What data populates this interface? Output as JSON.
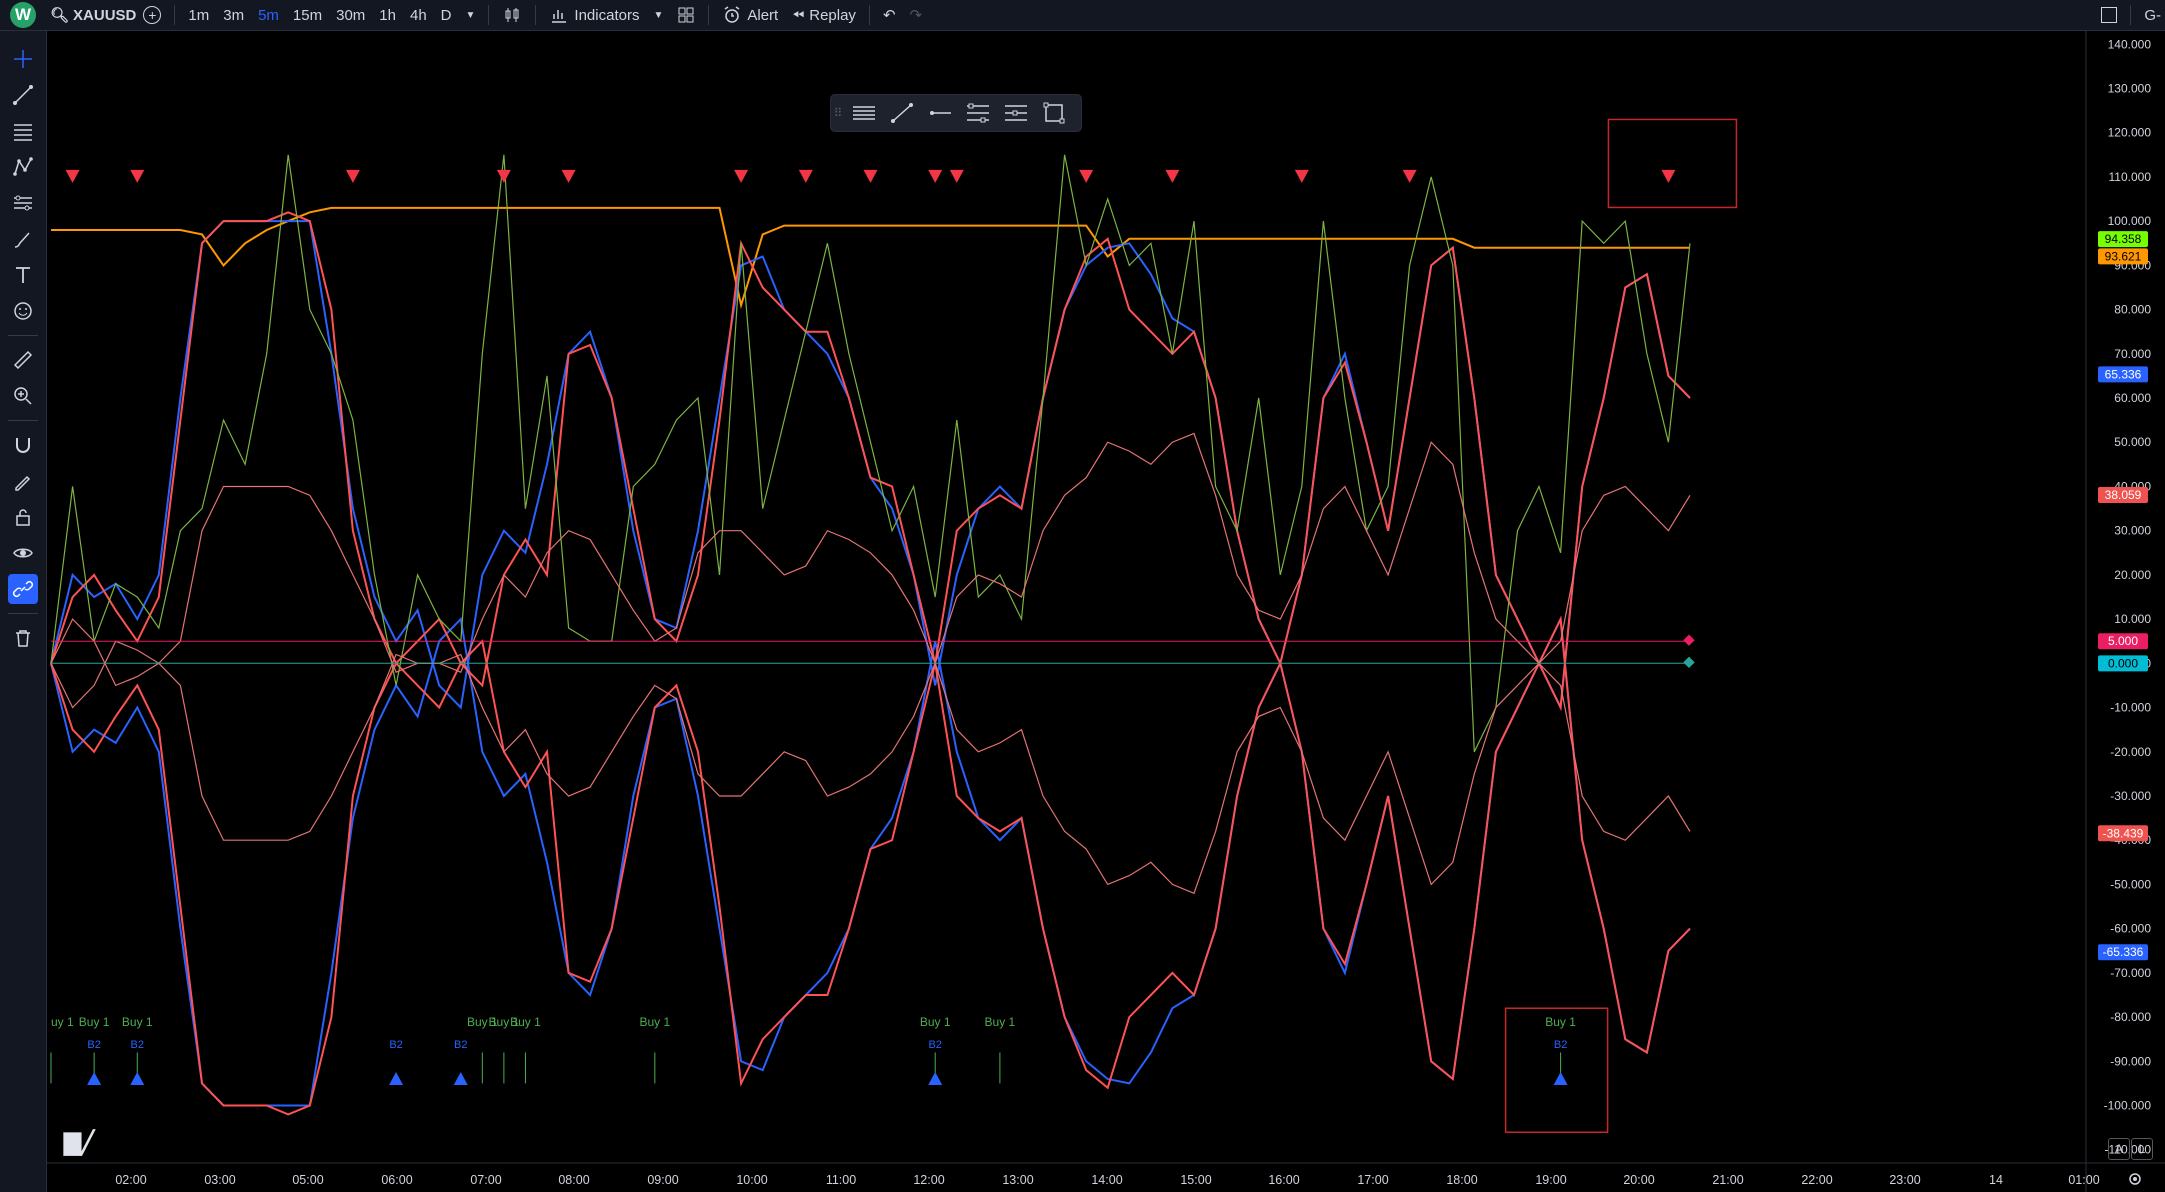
{
  "app": {
    "logo_letter": "W",
    "symbol": "XAUUSD",
    "timeframes": [
      "1m",
      "3m",
      "5m",
      "15m",
      "30m",
      "1h",
      "4h",
      "D"
    ],
    "active_timeframe": "5m",
    "indicators_label": "Indicators",
    "alert_label": "Alert",
    "replay_label": "Replay",
    "right_label": "G-",
    "accent_color": "#2962ff"
  },
  "chart": {
    "price_scale_labels": [
      "140.000",
      "130.000",
      "120.000",
      "110.000",
      "100.000",
      "90.000",
      "80.000",
      "70.000",
      "60.000",
      "50.000",
      "40.000",
      "30.000",
      "20.000",
      "10.000",
      "0.000",
      "-10.000",
      "-20.000",
      "-30.000",
      "-40.000",
      "-50.000",
      "-60.000",
      "-70.000",
      "-80.000",
      "-90.000",
      "-100.000",
      "-110.000"
    ],
    "time_labels": [
      "02:00",
      "03:00",
      "05:00",
      "06:00",
      "07:00",
      "08:00",
      "09:00",
      "10:00",
      "11:00",
      "12:00",
      "13:00",
      "14:00",
      "15:00",
      "16:00",
      "17:00",
      "18:00",
      "19:00",
      "20:00",
      "21:00",
      "22:00",
      "23:00",
      "14",
      "01:00"
    ],
    "badges": [
      {
        "text": "94.358",
        "value": 94.358,
        "color": "#76ff03",
        "text_color": "#000"
      },
      {
        "text": "93.621",
        "value": 93.621,
        "color": "#ff9800",
        "text_color": "#000"
      },
      {
        "text": "65.336",
        "value": 65.336,
        "color": "#2962ff",
        "text_color": "#fff"
      },
      {
        "text": "38.059",
        "value": 38.059,
        "color": "#ef5350",
        "text_color": "#fff"
      },
      {
        "text": "5.000",
        "value": 5.0,
        "color": "#e91e63",
        "text_color": "#fff"
      },
      {
        "text": "0.000",
        "value": 0.0,
        "color": "#00bcd4",
        "text_color": "#000"
      },
      {
        "text": "-38.439",
        "value": -38.439,
        "color": "#ef5350",
        "text_color": "#fff"
      },
      {
        "text": "-65.336",
        "value": -65.336,
        "color": "#2962ff",
        "text_color": "#fff"
      }
    ],
    "signal_label_buy": "Buy 1",
    "signal_label_buy_partial": "uy 1",
    "signal_label_b2": "B2",
    "corner_buttons": [
      "A",
      "L"
    ]
  },
  "chart_data": {
    "type": "line",
    "ylim": [
      -113,
      143
    ],
    "x": [
      "01:30",
      "01:45",
      "02:00",
      "02:15",
      "02:30",
      "02:45",
      "03:00",
      "03:15",
      "03:30",
      "03:45",
      "04:00",
      "04:15",
      "04:30",
      "04:45",
      "05:00",
      "05:15",
      "05:30",
      "05:45",
      "06:00",
      "06:15",
      "06:30",
      "06:45",
      "07:00",
      "07:15",
      "07:30",
      "07:45",
      "08:00",
      "08:15",
      "08:30",
      "08:45",
      "09:00",
      "09:15",
      "09:30",
      "09:45",
      "10:00",
      "10:15",
      "10:30",
      "10:45",
      "11:00",
      "11:15",
      "11:30",
      "11:45",
      "12:00",
      "12:15",
      "12:30",
      "12:45",
      "13:00",
      "13:15",
      "13:30",
      "13:45",
      "14:00",
      "14:15",
      "14:30",
      "14:45",
      "15:00",
      "15:15",
      "15:30",
      "15:45",
      "16:00",
      "16:15",
      "16:30",
      "16:45",
      "17:00",
      "17:15",
      "17:30",
      "17:45",
      "18:00",
      "18:15",
      "18:30",
      "18:45",
      "19:00",
      "19:15",
      "19:30",
      "19:45",
      "20:00",
      "20:15",
      "20:30"
    ],
    "series": [
      {
        "color": "#ff9800",
        "values": [
          98,
          98,
          98,
          98,
          98,
          98,
          98,
          97,
          90,
          95,
          98,
          100,
          102,
          103,
          103,
          103,
          103,
          103,
          103,
          103,
          103,
          103,
          103,
          103,
          103,
          103,
          103,
          103,
          103,
          103,
          103,
          103,
          81,
          97,
          99,
          99,
          99,
          99,
          99,
          99,
          99,
          99,
          99,
          99,
          99,
          99,
          99,
          99,
          99,
          92,
          96,
          96,
          96,
          96,
          96,
          96,
          96,
          96,
          96,
          96,
          96,
          96,
          96,
          96,
          96,
          96,
          94,
          94,
          94,
          94,
          94,
          94,
          94,
          94,
          94,
          94,
          94
        ]
      },
      {
        "color": "#2962ff",
        "values": [
          0,
          20,
          15,
          18,
          10,
          20,
          60,
          95,
          100,
          100,
          100,
          100,
          100,
          70,
          35,
          15,
          5,
          12,
          -5,
          -10,
          20,
          30,
          25,
          45,
          70,
          75,
          60,
          30,
          10,
          8,
          30,
          60,
          90,
          92,
          80,
          75,
          70,
          60,
          42,
          35,
          20,
          -5,
          20,
          35,
          40,
          35,
          60,
          80,
          90,
          94,
          95,
          88,
          78,
          75,
          60,
          30,
          10,
          0,
          20,
          60,
          70,
          50,
          30,
          60,
          90,
          94,
          60,
          20,
          10,
          0,
          -10,
          40,
          60,
          85,
          88,
          65,
          60
        ]
      },
      {
        "color": "#2962ff",
        "values": [
          0,
          -20,
          -15,
          -18,
          -10,
          -20,
          -60,
          -95,
          -100,
          -100,
          -100,
          -100,
          -100,
          -70,
          -35,
          -15,
          -5,
          -12,
          5,
          10,
          -20,
          -30,
          -25,
          -45,
          -70,
          -75,
          -60,
          -30,
          -10,
          -8,
          -30,
          -60,
          -90,
          -92,
          -80,
          -75,
          -70,
          -60,
          -42,
          -35,
          -20,
          5,
          -20,
          -35,
          -40,
          -35,
          -60,
          -80,
          -90,
          -94,
          -95,
          -88,
          -78,
          -75,
          -60,
          -30,
          -10,
          0,
          -20,
          -60,
          -70,
          -50,
          -30,
          -60,
          -90,
          -94,
          -60,
          -20,
          -10,
          0,
          10,
          -40,
          -60,
          -85,
          -88,
          -65,
          -60
        ]
      },
      {
        "color": "#ff5252",
        "values": [
          0,
          15,
          20,
          12,
          5,
          15,
          55,
          95,
          100,
          100,
          100,
          102,
          100,
          80,
          30,
          10,
          0,
          5,
          10,
          0,
          -5,
          20,
          28,
          20,
          70,
          72,
          60,
          35,
          10,
          5,
          20,
          55,
          95,
          85,
          80,
          75,
          75,
          60,
          42,
          40,
          20,
          0,
          30,
          35,
          38,
          35,
          60,
          80,
          92,
          96,
          80,
          75,
          70,
          75,
          60,
          30,
          10,
          0,
          20,
          60,
          68,
          50,
          30,
          60,
          90,
          94,
          60,
          20,
          10,
          0,
          -10,
          40,
          60,
          85,
          88,
          65,
          60
        ]
      },
      {
        "color": "#ff5252",
        "values": [
          0,
          -15,
          -20,
          -12,
          -5,
          -15,
          -55,
          -95,
          -100,
          -100,
          -100,
          -102,
          -100,
          -80,
          -30,
          -10,
          0,
          -5,
          -10,
          0,
          5,
          -20,
          -28,
          -20,
          -70,
          -72,
          -60,
          -35,
          -10,
          -5,
          -20,
          -55,
          -95,
          -85,
          -80,
          -75,
          -75,
          -60,
          -42,
          -40,
          -20,
          0,
          -30,
          -35,
          -38,
          -35,
          -60,
          -80,
          -92,
          -96,
          -80,
          -75,
          -70,
          -75,
          -60,
          -30,
          -10,
          0,
          -20,
          -60,
          -68,
          -50,
          -30,
          -60,
          -90,
          -94,
          -60,
          -20,
          -10,
          0,
          10,
          -40,
          -60,
          -85,
          -88,
          -65,
          -60
        ]
      },
      {
        "color": "#7cb342",
        "values": [
          0,
          40,
          5,
          18,
          15,
          8,
          30,
          35,
          55,
          45,
          70,
          115,
          80,
          70,
          55,
          20,
          -5,
          20,
          10,
          5,
          70,
          115,
          35,
          65,
          8,
          5,
          5,
          40,
          45,
          55,
          60,
          20,
          95,
          35,
          55,
          75,
          95,
          70,
          50,
          30,
          40,
          15,
          55,
          15,
          20,
          10,
          60,
          115,
          90,
          105,
          90,
          95,
          70,
          100,
          40,
          30,
          60,
          20,
          40,
          100,
          60,
          30,
          40,
          90,
          110,
          90,
          -20,
          -10,
          30,
          40,
          25,
          100,
          95,
          100,
          70,
          50,
          95
        ]
      },
      {
        "color": "#e57373",
        "values": [
          0,
          10,
          5,
          -5,
          -3,
          0,
          5,
          30,
          40,
          40,
          40,
          40,
          38,
          30,
          20,
          10,
          -2,
          0,
          0,
          -2,
          10,
          20,
          15,
          25,
          30,
          28,
          20,
          12,
          5,
          8,
          25,
          30,
          30,
          25,
          20,
          22,
          30,
          28,
          25,
          20,
          12,
          0,
          15,
          20,
          18,
          15,
          30,
          38,
          42,
          50,
          48,
          45,
          50,
          52,
          38,
          20,
          12,
          10,
          20,
          35,
          40,
          30,
          20,
          35,
          50,
          45,
          25,
          10,
          5,
          0,
          5,
          30,
          38,
          40,
          35,
          30,
          38
        ]
      },
      {
        "color": "#e57373",
        "values": [
          0,
          -10,
          -5,
          5,
          3,
          0,
          -5,
          -30,
          -40,
          -40,
          -40,
          -40,
          -38,
          -30,
          -20,
          -10,
          2,
          0,
          0,
          2,
          -10,
          -20,
          -15,
          -25,
          -30,
          -28,
          -20,
          -12,
          -5,
          -8,
          -25,
          -30,
          -30,
          -25,
          -20,
          -22,
          -30,
          -28,
          -25,
          -20,
          -12,
          0,
          -15,
          -20,
          -18,
          -15,
          -30,
          -38,
          -42,
          -50,
          -48,
          -45,
          -50,
          -52,
          -38,
          -20,
          -12,
          -10,
          -20,
          -35,
          -40,
          -30,
          -20,
          -35,
          -50,
          -45,
          -25,
          -10,
          -5,
          0,
          -5,
          -30,
          -38,
          -40,
          -35,
          -30,
          -38
        ]
      },
      {
        "color": "#e91e63",
        "values": [
          5,
          5,
          5,
          5,
          5,
          5,
          5,
          5,
          5,
          5,
          5,
          5,
          5,
          5,
          5,
          5,
          5,
          5,
          5,
          5,
          5,
          5,
          5,
          5,
          5,
          5,
          5,
          5,
          5,
          5,
          5,
          5,
          5,
          5,
          5,
          5,
          5,
          5,
          5,
          5,
          5,
          5,
          5,
          5,
          5,
          5,
          5,
          5,
          5,
          5,
          5,
          5,
          5,
          5,
          5,
          5,
          5,
          5,
          5,
          5,
          5,
          5,
          5,
          5,
          5,
          5,
          5,
          5,
          5,
          5,
          5,
          5,
          5,
          5,
          5,
          5,
          5
        ]
      },
      {
        "color": "#26a69a",
        "values": [
          0,
          0,
          0,
          0,
          0,
          0,
          0,
          0,
          0,
          0,
          0,
          0,
          0,
          0,
          0,
          0,
          0,
          0,
          0,
          0,
          0,
          0,
          0,
          0,
          0,
          0,
          0,
          0,
          0,
          0,
          0,
          0,
          0,
          0,
          0,
          0,
          0,
          0,
          0,
          0,
          0,
          0,
          0,
          0,
          0,
          0,
          0,
          0,
          0,
          0,
          0,
          0,
          0,
          0,
          0,
          0,
          0,
          0,
          0,
          0,
          0,
          0,
          0,
          0,
          0,
          0,
          0,
          0,
          0,
          0,
          0,
          0,
          0,
          0,
          0,
          0,
          0
        ]
      }
    ],
    "sell_marker_times": [
      "01:45",
      "02:30",
      "05:00",
      "06:45",
      "07:30",
      "09:30",
      "10:15",
      "11:00",
      "11:45",
      "12:00",
      "13:30",
      "14:30",
      "16:00",
      "17:15",
      "20:15"
    ],
    "buy_signal_times": [
      "01:30",
      "02:00",
      "02:30",
      "06:30",
      "06:45",
      "07:00",
      "08:30",
      "11:45",
      "12:30",
      "19:00"
    ],
    "b2_signal_times": [
      "02:00",
      "02:30",
      "05:30",
      "06:15",
      "11:45",
      "19:00"
    ],
    "grid": false
  }
}
